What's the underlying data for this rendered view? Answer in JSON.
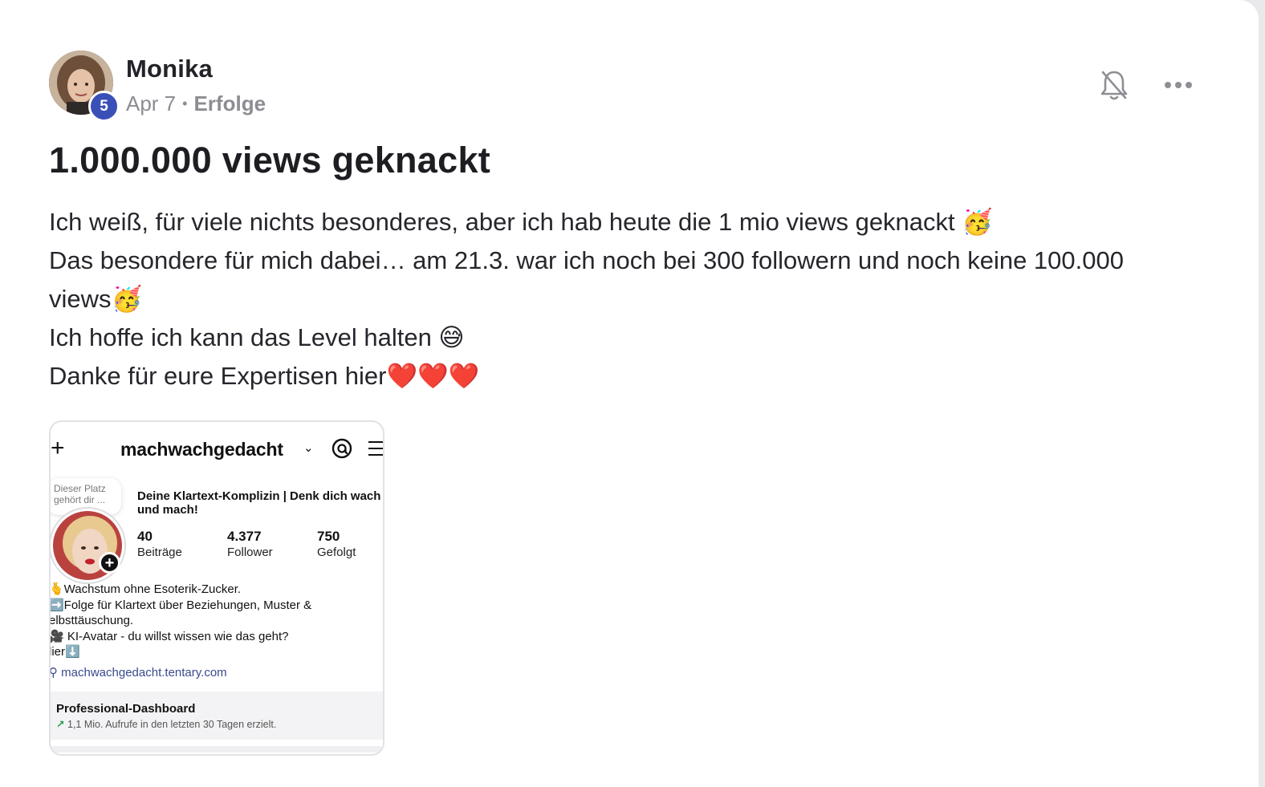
{
  "post": {
    "author": "Monika",
    "level": "5",
    "date": "Apr 7",
    "separator": "•",
    "category": "Erfolge",
    "title": "1.000.000 views geknackt",
    "body_lines": [
      "Ich weiß, für viele nichts besonderes, aber ich hab heute die 1 mio views geknackt 🥳",
      "Das besondere für mich dabei… am 21.3. war ich noch bei 300 followern und noch keine 100.000 views🥳",
      "Ich hoffe ich kann das Level halten 😅",
      "Danke für eure Expertisen hier❤️❤️❤️"
    ]
  },
  "header_actions": {
    "bell_icon": "bell-off-icon",
    "more_icon": "more-horizontal-icon"
  },
  "embed": {
    "plus": "+",
    "username": "machwachgedacht",
    "chevron": "⌄",
    "note": "Dieser Platz gehört dir ...",
    "add": "+",
    "display_name_l1": "Deine Klartext-Komplizin | Denk dich wach",
    "display_name_l2": "und mach!",
    "stats": [
      {
        "num": "40",
        "label": "Beiträge"
      },
      {
        "num": "4.377",
        "label": "Follower"
      },
      {
        "num": "750",
        "label": "Gefolgt"
      }
    ],
    "bio": [
      "🫰Wachstum ohne Esoterik-Zucker.",
      "➡️Folge für Klartext über Beziehungen, Muster &",
      "elbsttäuschung.",
      "🎥 KI-Avatar - du willst wissen wie das geht?",
      "lier⬇️"
    ],
    "link": "machwachgedacht.tentary.com",
    "dashboard_title": "Professional-Dashboard",
    "dashboard_arrow": "↗",
    "dashboard_text": "1,1 Mio. Aufrufe in den letzten 30 Tagen erzielt."
  },
  "colors": {
    "level_badge": "#3b4fb8",
    "meta_text": "#8c8c93",
    "link": "#3a4a8c"
  }
}
